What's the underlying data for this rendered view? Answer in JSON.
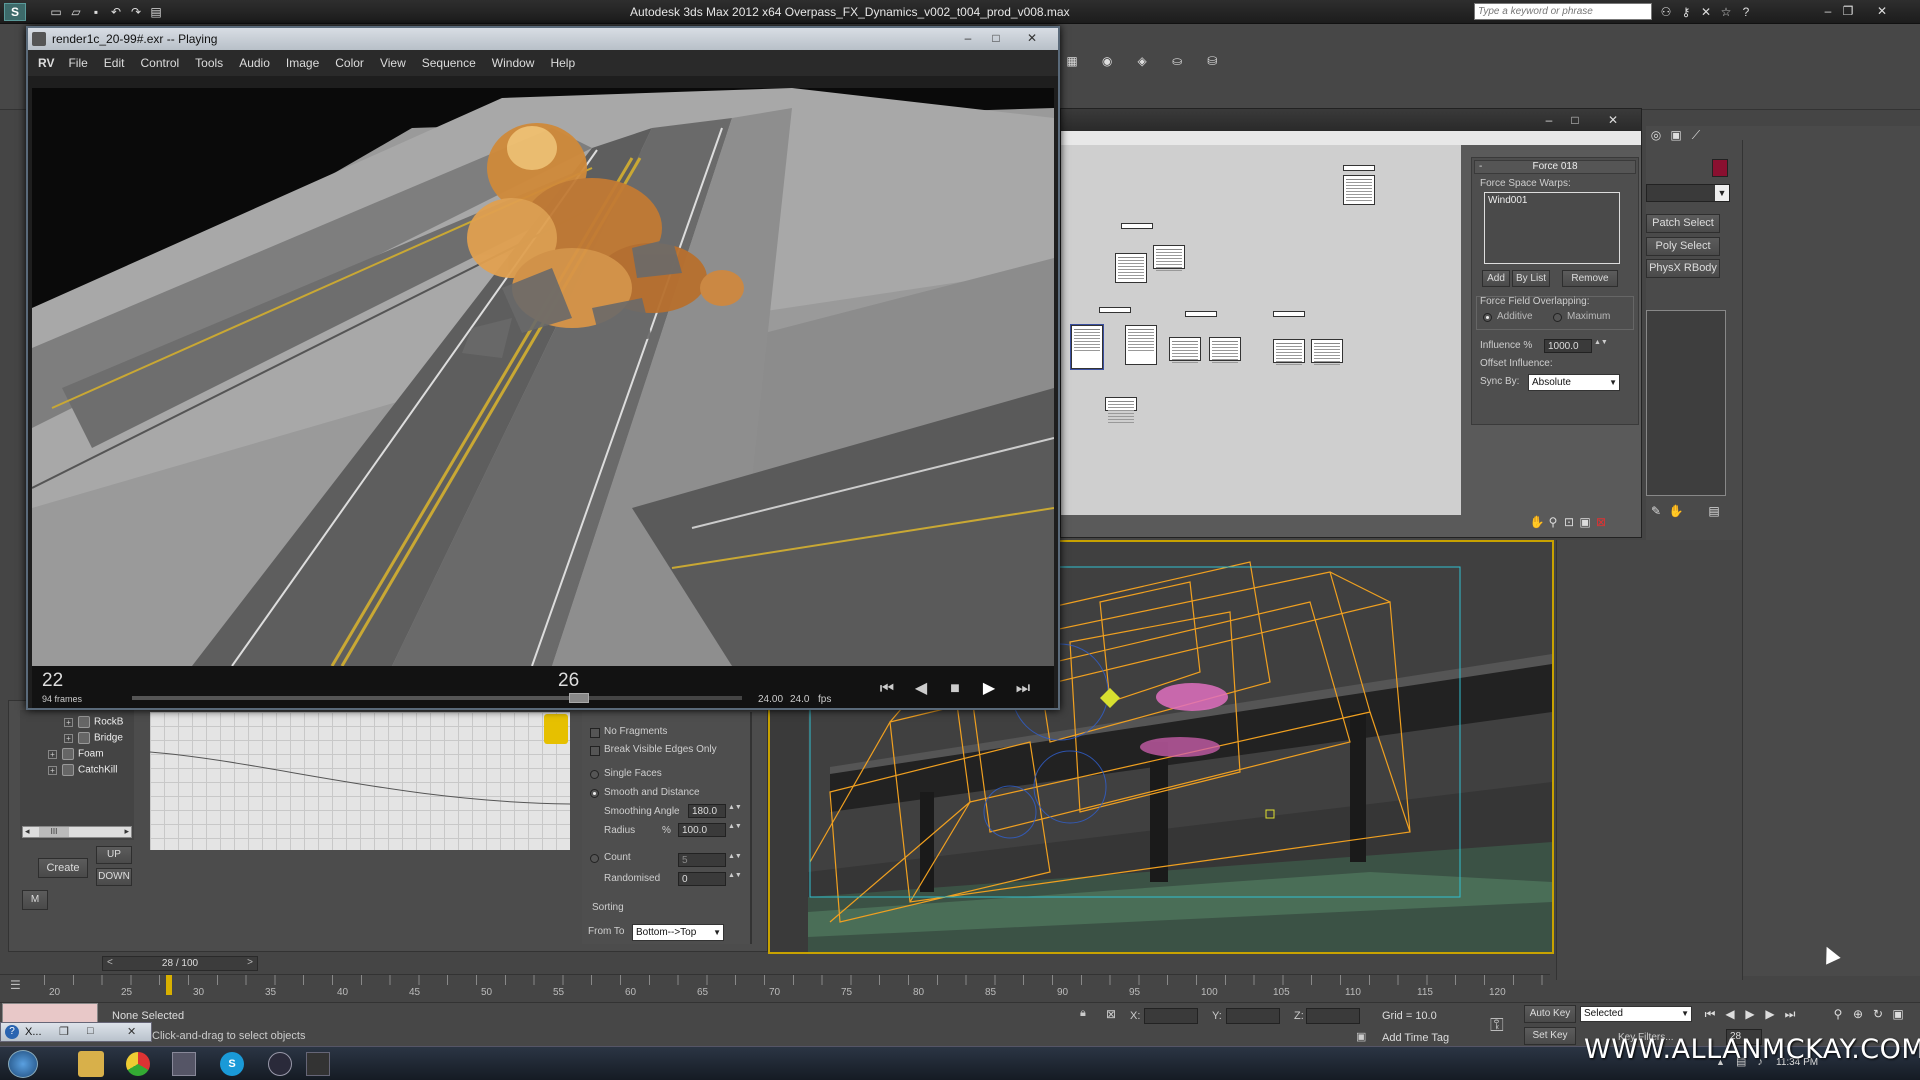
{
  "max": {
    "title": "Autodesk 3ds Max  2012 x64     Overpass_FX_Dynamics_v002_t004_prod_v008.max",
    "search_placeholder": "Type a keyword or phrase"
  },
  "rv": {
    "title": "render1c_20-99#.exr -- Playing",
    "menu": [
      "RV",
      "File",
      "Edit",
      "Control",
      "Tools",
      "Audio",
      "Image",
      "Color",
      "View",
      "Sequence",
      "Window",
      "Help"
    ],
    "frame_start": "22",
    "frame_count": "94 frames",
    "frame_current": "26",
    "fps_target": "24.00",
    "fps_actual": "24.0",
    "fps_unit": "fps"
  },
  "modifier": {
    "top_buttons": [
      "Patch Select",
      "Poly Select",
      "PhysX RBody"
    ]
  },
  "force_panel": {
    "header": "Force 018",
    "warps_label": "Force Space Warps:",
    "warps_items": [
      "Wind001"
    ],
    "add": "Add",
    "by_list": "By List",
    "remove": "Remove",
    "overlap_label": "Force Field Overlapping:",
    "additive": "Additive",
    "maximum": "Maximum",
    "influence_label": "Influence %",
    "influence_value": "1000.0",
    "offset_label": "Offset Influence:",
    "sync_label": "Sync By:",
    "sync_value": "Absolute"
  },
  "scene_tree": {
    "items": [
      "RockB",
      "Bridge",
      "Foam",
      "CatchKill"
    ],
    "scroll_label": "III",
    "create": "Create",
    "up": "UP",
    "down": "DOWN",
    "m": "M"
  },
  "frag": {
    "no_fragments": "No Fragments",
    "break_visible": "Break Visible Edges Only",
    "single_faces": "Single Faces",
    "smooth_distance": "Smooth and Distance",
    "smoothing_angle_label": "Smoothing Angle",
    "smoothing_angle_value": "180.0",
    "radius_label": "Radius",
    "radius_pct": "%",
    "radius_value": "100.0",
    "count_label": "Count",
    "count_value": "5",
    "randomised_label": "Randomised",
    "randomised_value": "0",
    "sorting_label": "Sorting",
    "from_to_label": "From To",
    "from_to_value": "Bottom-->Top"
  },
  "timeline": {
    "slider_text": "28 / 100",
    "ticks": [
      "20",
      "25",
      "30",
      "35",
      "40",
      "45",
      "50",
      "55",
      "60",
      "65",
      "70",
      "75",
      "80",
      "85",
      "90",
      "95",
      "100",
      "105",
      "110",
      "115",
      "120"
    ]
  },
  "status": {
    "selection": "None Selected",
    "prompt": "Click-and-drag to select objects",
    "x_label": "X:",
    "y_label": "Y:",
    "z_label": "Z:",
    "grid": "Grid = 10.0",
    "add_time_tag": "Add Time Tag",
    "auto_key": "Auto Key",
    "set_key": "Set Key",
    "key_mode": "Selected",
    "key_filters": "Key Filters...",
    "frame_field": "28"
  },
  "mini_window": {
    "label": "X..."
  },
  "taskbar": {
    "clock": "11:34 PM"
  },
  "watermark": "WWW.ALLANMCKAY.COM"
}
